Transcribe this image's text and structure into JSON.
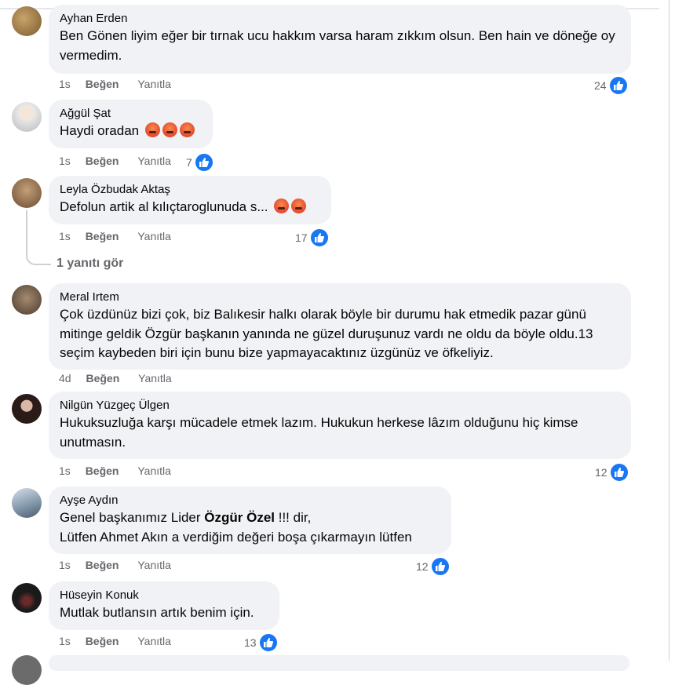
{
  "comments": [
    {
      "author": "Ayhan Erden",
      "text": "Ben Gönen liyim eğer bir tırnak ucu hakkım varsa haram zıkkım olsun. Ben hain ve döneğe oy vermedim.",
      "time": "1s",
      "like_label": "Beğen",
      "reply_label": "Yanıtla",
      "reactions": "24",
      "avatar_color": "#8a6a3c"
    },
    {
      "author": "Ağgül Şat",
      "text": "Haydi oradan",
      "emojis": 3,
      "time": "1s",
      "like_label": "Beğen",
      "reply_label": "Yanıtla",
      "reactions": "7",
      "avatar_color": "#c9c9c9"
    },
    {
      "author": "Leyla Özbudak Aktaş",
      "text": "Defolun artik al kılıçtaroglunuda s...",
      "emojis": 2,
      "time": "1s",
      "like_label": "Beğen",
      "reply_label": "Yanıtla",
      "reactions": "17",
      "avatar_color": "#9b7b5a",
      "see_replies": "1 yanıtı gör"
    },
    {
      "author": "Meral Irtem",
      "text": "Çok üzdünüz bizi çok, biz Balıkesir halkı olarak böyle bir durumu hak etmedik pazar günü mitinge geldik Özgür başkanın yanında ne güzel duruşunuz vardı ne oldu da böyle oldu.13 seçim kaybeden biri için bunu bize yapmayacaktınız üzgünüz ve öfkeliyiz.",
      "time": "4d",
      "like_label": "Beğen",
      "reply_label": "Yanıtla",
      "reactions": "",
      "avatar_color": "#6c5a4a"
    },
    {
      "author": "Nilgün Yüzgeç Ülgen",
      "text": "Hukuksuzluğa karşı mücadele etmek lazım. Hukukun herkese lâzım olduğunu hiç kimse unutmasın.",
      "time": "1s",
      "like_label": "Beğen",
      "reply_label": "Yanıtla",
      "reactions": "12",
      "avatar_color": "#3b2a26"
    },
    {
      "author": "Ayşe Aydın",
      "text_line1_pre": "Genel başkanımız Lider ",
      "text_line1_bold": "Özgür Özel",
      "text_line1_post": " !!! dir,",
      "text_line2": "Lütfen Ahmet Akın a verdiğim değeri boşa çıkarmayın lütfen",
      "time": "1s",
      "like_label": "Beğen",
      "reply_label": "Yanıtla",
      "reactions": "12",
      "avatar_color": "#8fa4b8"
    },
    {
      "author": "Hüseyin Konuk",
      "text": "Mutlak butlansın artık benim için.",
      "time": "1s",
      "like_label": "Beğen",
      "reply_label": "Yanıtla",
      "reactions": "13",
      "avatar_color": "#2a2a2a"
    }
  ],
  "colors": {
    "like_blue": "#1877f2",
    "bubble": "#f0f2f5",
    "meta": "#65676b"
  }
}
